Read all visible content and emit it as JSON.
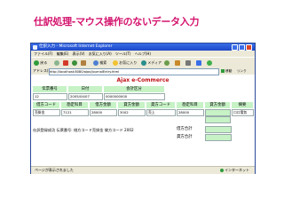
{
  "slide": {
    "title": "仕訳処理-マウス操作のないデータ入力"
  },
  "window": {
    "title": "仕訳入力 - Microsoft Internet Explorer",
    "menu": [
      "ファイル(F)",
      "編集(E)",
      "表示(V)",
      "お気に入り(A)",
      "ツール(T)",
      "ヘルプ(H)"
    ],
    "toolbar": {
      "back": "戻る",
      "search": "検索",
      "favorites": "お気に入り",
      "media": "メディア"
    },
    "address_label": "アドレス(D)",
    "address_value": "http://localhost:8080/ajax/journalEntry.html",
    "go": "移動",
    "links": "リンク",
    "status": "ページが表示されました",
    "zone": "インターネット"
  },
  "app": {
    "title": "Ajax e-Commerce",
    "header1": {
      "slip_no": "伝票番号",
      "date": "日付",
      "fiscal": "会計区分"
    },
    "row1": {
      "slip_no": "12",
      "date": "2005/04/07",
      "fiscal": "0000000000"
    },
    "header2": {
      "debit_code": "借方コード",
      "debit_subject": "勘定科目",
      "debit_amount": "借方金額",
      "credit_amount": "貸方金額",
      "credit_code": "貸方コード",
      "credit_subject": "勘定科目",
      "credit_amount2": "貸方金額",
      "memo": "摘要"
    },
    "row2": {
      "debit_code": "売掛金",
      "debit_subject": "7121",
      "debit_amount": "28000",
      "credit_amount": "3002",
      "credit_code": "売上",
      "credit_subject": "28000",
      "credit_amount2": "",
      "memo": "ロロ電気"
    },
    "message": "仕訳登録成功 伝票番号: 借方コード売掛金 貸方コード 2002",
    "totals": {
      "debit_label": "借方合計",
      "credit_label": "貸方合計"
    }
  }
}
